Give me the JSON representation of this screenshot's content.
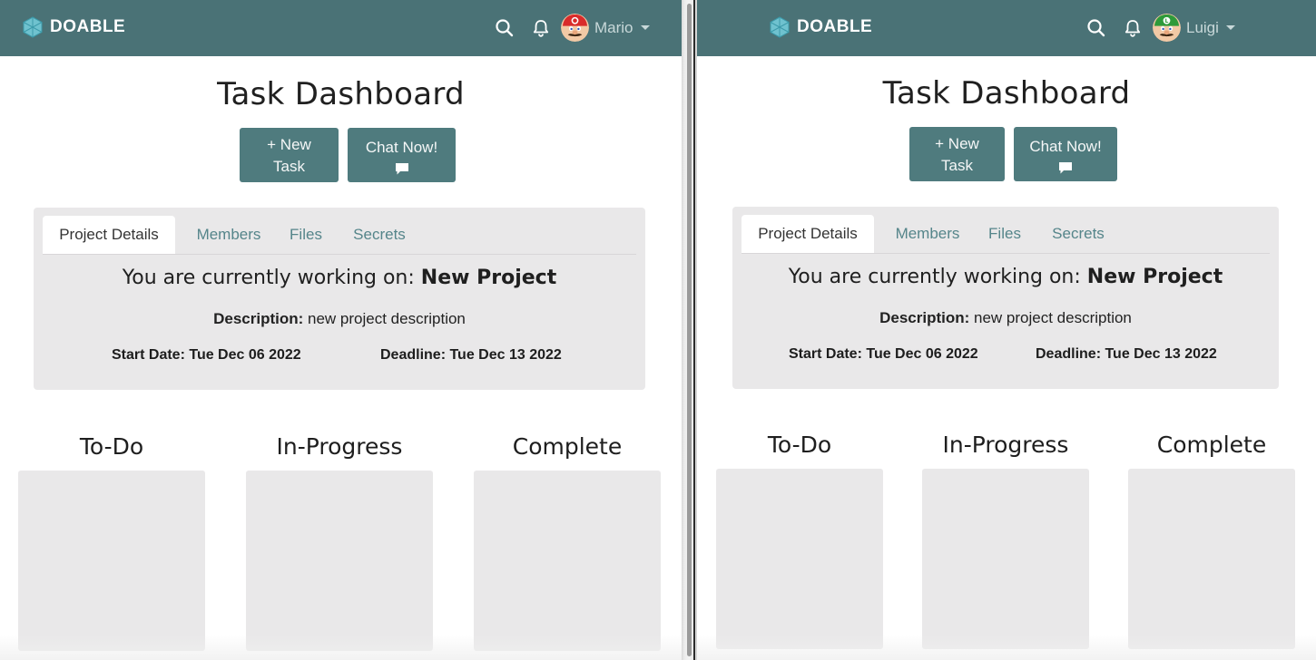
{
  "left": {
    "brand": "DOABLE",
    "user_name": "Mario",
    "page_title": "Task Dashboard",
    "new_task_label": "+ New",
    "new_task_label2": "Task",
    "chat_label": "Chat Now!",
    "tabs": [
      "Project Details",
      "Members",
      "Files",
      "Secrets"
    ],
    "working_prefix": "You are currently working on:",
    "project_name": "New Project",
    "description_label": "Description:",
    "description_value": "new project description",
    "start_date": "Start Date: Tue Dec 06 2022",
    "deadline": "Deadline: Tue Dec 13 2022",
    "columns": [
      "To-Do",
      "In-Progress",
      "Complete"
    ]
  },
  "right": {
    "brand": "DOABLE",
    "user_name": "Luigi",
    "page_title": "Task Dashboard",
    "new_task_label": "+ New",
    "new_task_label2": "Task",
    "chat_label": "Chat Now!",
    "tabs": [
      "Project Details",
      "Members",
      "Files",
      "Secrets"
    ],
    "working_prefix": "You are currently working on:",
    "project_name": "New Project",
    "description_label": "Description:",
    "description_value": "new project description",
    "start_date": "Start Date: Tue Dec 06 2022",
    "deadline": "Deadline: Tue Dec 13 2022",
    "columns": [
      "To-Do",
      "In-Progress",
      "Complete"
    ]
  },
  "icons": {
    "brand_logo": "hexagon-logo-icon",
    "search": "search-icon",
    "notifications": "bell-icon",
    "chat": "chat-bubble-icon",
    "user_menu": "chevron-down-icon"
  },
  "colors": {
    "navbar": "#4a7276",
    "button": "#4f7b7e",
    "tab_link": "#55858a",
    "card_background": "#e9e8e9"
  }
}
